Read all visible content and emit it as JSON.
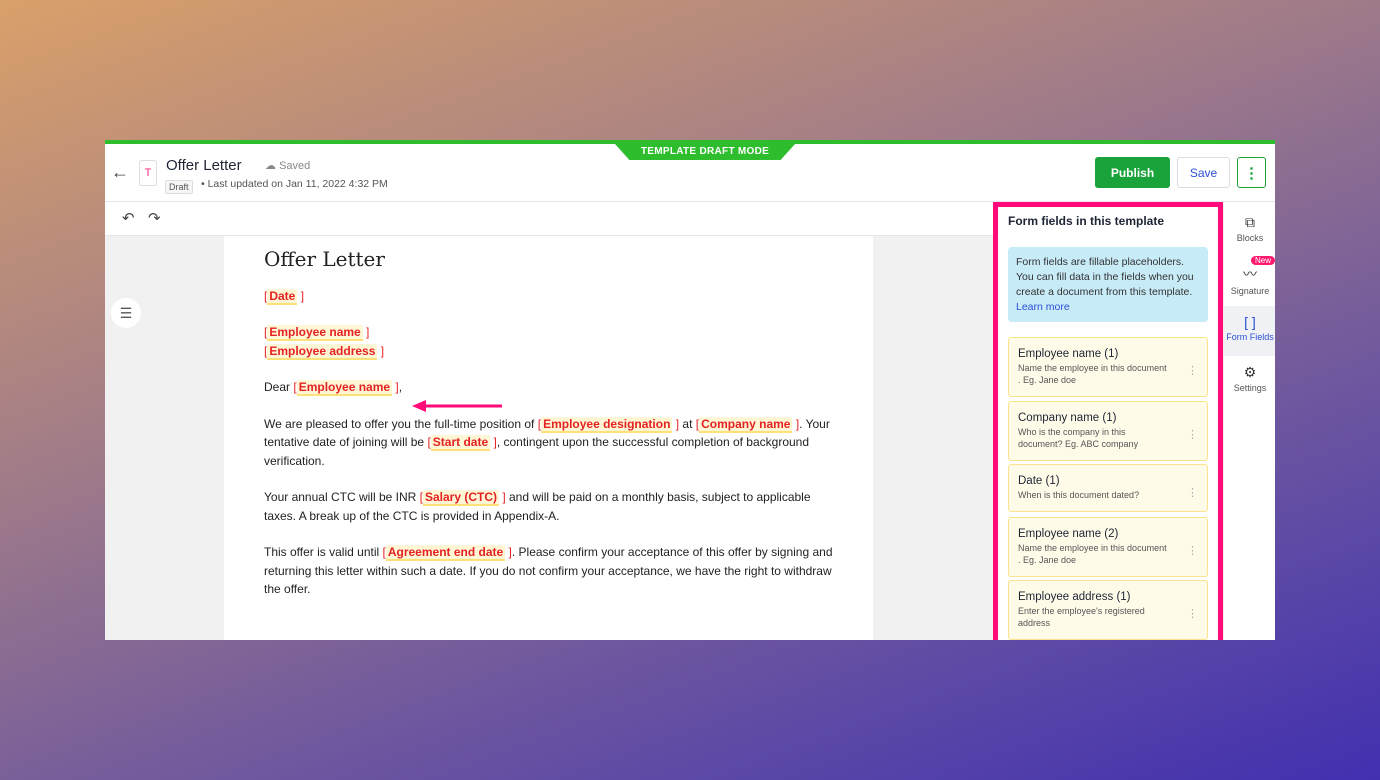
{
  "header": {
    "mode_banner": "TEMPLATE DRAFT MODE",
    "doc_icon_letter": "T",
    "title": "Offer Letter",
    "save_status": "Saved",
    "status_badge": "Draft",
    "last_updated": "Last updated on Jan 11, 2022 4:32 PM",
    "publish_label": "Publish",
    "save_label": "Save",
    "more_label": "⋮"
  },
  "toolbar": {
    "undo": "↶",
    "redo": "↷"
  },
  "document": {
    "heading": "Offer Letter",
    "paragraphs": [
      [
        {
          "f": "Date"
        }
      ],
      [
        {
          "f": "Employee name"
        },
        {
          "br": true
        },
        {
          "f": "Employee address"
        }
      ],
      [
        {
          "t": "Dear "
        },
        {
          "f": "Employee name"
        },
        {
          "t": ","
        }
      ],
      [
        {
          "t": "We are pleased to offer you the full-time position of "
        },
        {
          "f": "Employee designation"
        },
        {
          "t": " at "
        },
        {
          "f": "Company name"
        },
        {
          "t": ". Your tentative date of joining will be "
        },
        {
          "f": "Start date"
        },
        {
          "t": ", contingent upon the successful completion of background verification."
        }
      ],
      [
        {
          "t": "Your annual CTC will be INR "
        },
        {
          "f": "Salary (CTC)"
        },
        {
          "t": " and will be paid on a monthly basis, subject to applicable taxes. A break up of the CTC is provided in Appendix-A."
        }
      ],
      [
        {
          "t": "This offer is valid until "
        },
        {
          "f": "Agreement end date"
        },
        {
          "t": ". Please confirm your acceptance of this offer by signing and returning this letter within such a date. If you do not confirm your acceptance, we have the right to withdraw the offer."
        }
      ]
    ]
  },
  "panel": {
    "title": "Form fields in this template",
    "info": "Form fields are fillable placeholders. You can fill data in the fields when you create a document from this template. ",
    "learn_more": "Learn more",
    "fields": [
      {
        "name": "Employee name (1)",
        "desc": "Name the employee in this document . Eg. Jane doe"
      },
      {
        "name": "Company name (1)",
        "desc": "Who is the company in this document? Eg. ABC company"
      },
      {
        "name": "Date (1)",
        "desc": "When is this document dated?"
      },
      {
        "name": "Employee name (2)",
        "desc": "Name the employee in this document . Eg. Jane doe"
      },
      {
        "name": "Employee address (1)",
        "desc": "Enter the employee's registered address"
      }
    ]
  },
  "rail": {
    "items": [
      {
        "label": "Blocks",
        "icon": "puzzle-icon"
      },
      {
        "label": "Signature",
        "icon": "signature-icon",
        "badge": "New"
      },
      {
        "label": "Form Fields",
        "icon": "brackets-icon",
        "active": true
      },
      {
        "label": "Settings",
        "icon": "gear-icon"
      }
    ]
  },
  "colors": {
    "accent_green": "#1aa33a",
    "highlight_pink": "#ff0a78",
    "field_red": "#e52222",
    "link_blue": "#2b4fd6"
  }
}
